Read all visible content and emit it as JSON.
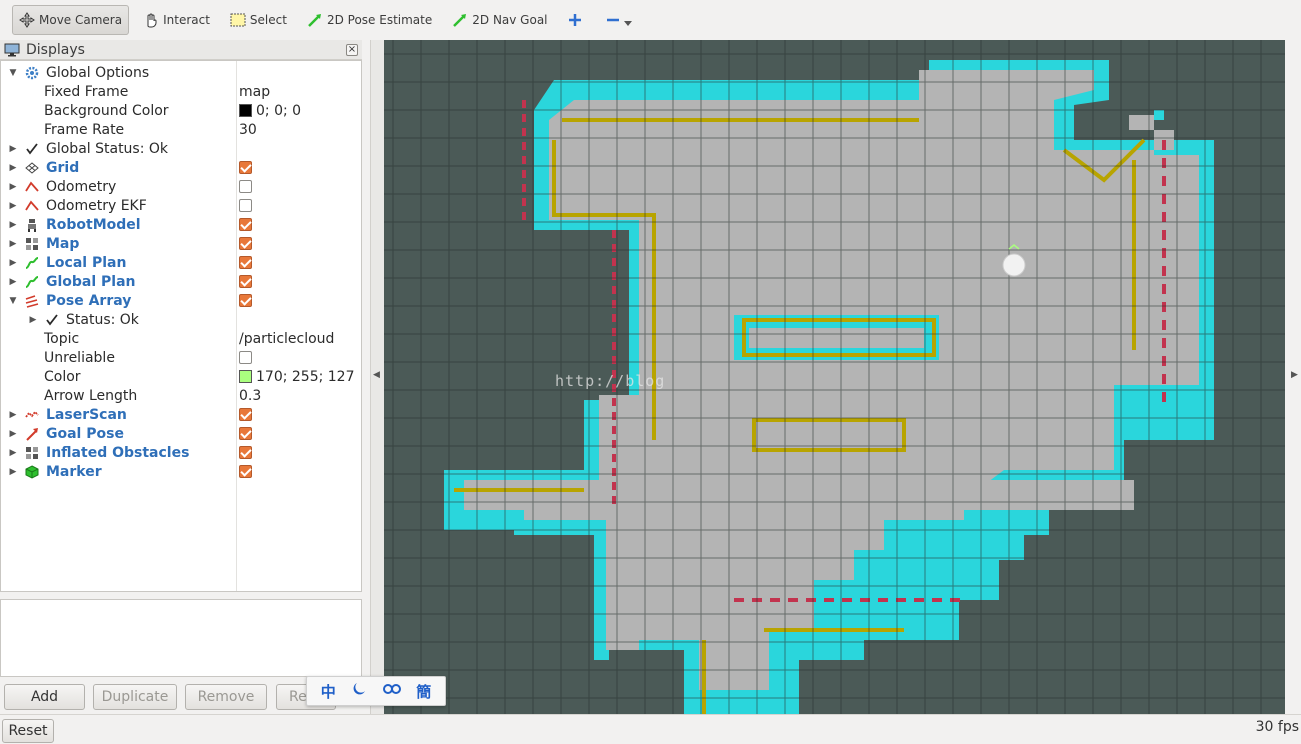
{
  "toolbar": {
    "move_camera": "Move Camera",
    "interact": "Interact",
    "select": "Select",
    "pose_estimate": "2D Pose Estimate",
    "nav_goal": "2D Nav Goal"
  },
  "panel": {
    "title": "Displays",
    "close": "×"
  },
  "tree": {
    "global_options": "Global Options",
    "fixed_frame_label": "Fixed Frame",
    "fixed_frame_value": "map",
    "background_color_label": "Background Color",
    "background_color_value": "0; 0; 0",
    "frame_rate_label": "Frame Rate",
    "frame_rate_value": "30",
    "global_status": "Global Status: Ok",
    "grid": "Grid",
    "odometry": "Odometry",
    "odometry_ekf": "Odometry EKF",
    "robot_model": "RobotModel",
    "map": "Map",
    "local_plan": "Local Plan",
    "global_plan": "Global Plan",
    "pose_array": "Pose Array",
    "status_ok": "Status: Ok",
    "topic_label": "Topic",
    "topic_value": "/particlecloud",
    "unreliable_label": "Unreliable",
    "color_label": "Color",
    "color_value": "170; 255; 127",
    "arrow_length_label": "Arrow Length",
    "arrow_length_value": "0.3",
    "laser_scan": "LaserScan",
    "goal_pose": "Goal Pose",
    "inflated_obstacles": "Inflated Obstacles",
    "marker": "Marker"
  },
  "colors": {
    "background_swatch": "#000000",
    "pose_color_swatch": "#aaff7f",
    "link_blue": "#2f6fb8",
    "checkbox_orange": "#e8783a"
  },
  "buttons": {
    "add": "Add",
    "duplicate": "Duplicate",
    "remove": "Remove",
    "rename": "Re",
    "reset": "Reset"
  },
  "status": {
    "fps": "30 fps"
  },
  "watermark": "http://blog",
  "ime": {
    "zh": "中",
    "simplified": "簡"
  }
}
